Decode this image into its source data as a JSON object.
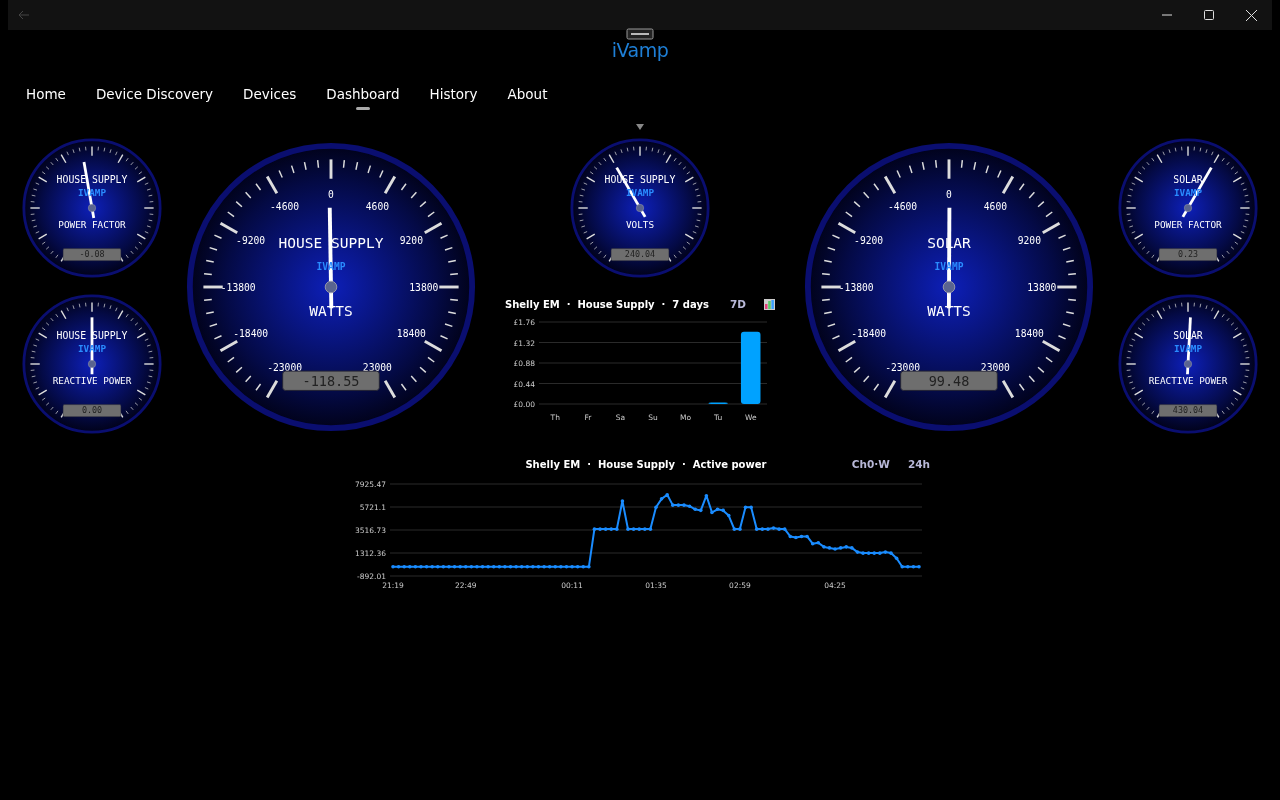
{
  "window": {
    "back_disabled": true
  },
  "app": {
    "logo": "iVamp"
  },
  "nav": [
    {
      "label": "Home",
      "selected": false
    },
    {
      "label": "Device Discovery",
      "selected": false
    },
    {
      "label": "Devices",
      "selected": false
    },
    {
      "label": "Dashboard",
      "selected": true
    },
    {
      "label": "History",
      "selected": false
    },
    {
      "label": "About",
      "selected": false
    }
  ],
  "gauges": [
    {
      "kind": "small",
      "title": "HOUSE SUPPLY",
      "brand": "IVAMP",
      "unit": "POWER FACTOR",
      "reading": "-0.08",
      "level": 0.467
    },
    {
      "kind": "small",
      "title": "HOUSE SUPPLY",
      "brand": "IVAMP",
      "unit": "REACTIVE POWER",
      "reading": "0.00",
      "level": 0.5
    },
    {
      "kind": "big",
      "title": "HOUSE SUPPLY",
      "brand": "IVAMP",
      "unit": "WATTS",
      "reading": "-118.55",
      "level": 0.497,
      "scale": [
        "0",
        "-4600",
        "4600",
        "-9200",
        "9200",
        "-13800",
        "13800",
        "-18400",
        "18400",
        "-23000",
        "23000"
      ]
    },
    {
      "kind": "small",
      "title": "HOUSE SUPPLY",
      "brand": "IVAMP",
      "unit": "VOLTS",
      "reading": "240.04",
      "level": 0.4
    },
    {
      "kind": "big",
      "title": "SOLAR",
      "brand": "IVAMP",
      "unit": "WATTS",
      "reading": "99.48",
      "level": 0.501,
      "scale": [
        "0",
        "-4600",
        "4600",
        "-9200",
        "9200",
        "-13800",
        "13800",
        "-18400",
        "18400",
        "-23000",
        "23000"
      ]
    },
    {
      "kind": "small",
      "title": "SOLAR",
      "brand": "IVAMP",
      "unit": "POWER FACTOR",
      "reading": "0.23",
      "level": 0.6
    },
    {
      "kind": "small",
      "title": "SOLAR",
      "brand": "IVAMP",
      "unit": "REACTIVE POWER",
      "reading": "430.04",
      "level": 0.51
    }
  ],
  "daily_chart": {
    "title": "Shelly EM  ·  House Supply  ·  7 days",
    "range": "7D",
    "chart_data": {
      "type": "bar",
      "grid": true,
      "categories": [
        "Th",
        "Fr",
        "Sa",
        "Su",
        "Mo",
        "Tu",
        "We"
      ],
      "series": [
        {
          "color": "#00a2ff",
          "values": [
            0,
            0,
            0,
            0,
            0,
            0.03,
            1.55
          ]
        }
      ],
      "ylim": [
        0,
        1.76
      ],
      "yticks": [
        {
          "value": 0,
          "label": "£0.00"
        },
        {
          "value": 0.44,
          "label": "£0.44"
        },
        {
          "value": 0.88,
          "label": "£0.88"
        },
        {
          "value": 1.32,
          "label": "£1.32"
        },
        {
          "value": 1.76,
          "label": "£1.76"
        }
      ]
    }
  },
  "power_chart": {
    "title": "Shelly EM  ·  House Supply  ·  Active power",
    "channel": "Ch0·W",
    "range": "24h",
    "chart_data": {
      "type": "line",
      "grid": true,
      "categories": [
        "21:19",
        null,
        null,
        null,
        null,
        null,
        null,
        null,
        null,
        null,
        null,
        null,
        null,
        "22:49",
        null,
        null,
        null,
        null,
        null,
        null,
        null,
        null,
        null,
        null,
        null,
        null,
        null,
        null,
        null,
        null,
        null,
        null,
        "00:11",
        null,
        null,
        null,
        null,
        null,
        null,
        null,
        null,
        null,
        null,
        null,
        null,
        null,
        null,
        "01:35",
        null,
        null,
        null,
        null,
        null,
        null,
        null,
        null,
        null,
        null,
        null,
        null,
        null,
        null,
        "02:59",
        null,
        null,
        null,
        null,
        null,
        null,
        null,
        null,
        null,
        null,
        null,
        null,
        null,
        null,
        null,
        null,
        "04:25",
        null,
        null,
        null,
        null,
        null,
        null,
        null,
        null,
        null,
        null,
        null,
        null,
        null,
        null,
        null
      ],
      "series": [
        {
          "color": "#1a8cff",
          "values": [
            0,
            0,
            0,
            0,
            0,
            0,
            0,
            0,
            0,
            0,
            0,
            0,
            0,
            0,
            0,
            0,
            0,
            0,
            0,
            0,
            0,
            0,
            0,
            0,
            0,
            0,
            0,
            0,
            0,
            0,
            0,
            0,
            0,
            0,
            0,
            0,
            3600,
            3600,
            3600,
            3600,
            3600,
            6300,
            3600,
            3600,
            3600,
            3600,
            3600,
            5700,
            6500,
            6900,
            5900,
            5900,
            5900,
            5800,
            5500,
            5400,
            6800,
            5200,
            5500,
            5400,
            4900,
            3600,
            3600,
            5700,
            5700,
            3600,
            3600,
            3600,
            3700,
            3600,
            3600,
            2900,
            2800,
            2900,
            2900,
            2200,
            2300,
            1900,
            1800,
            1700,
            1800,
            1900,
            1800,
            1400,
            1300,
            1300,
            1300,
            1300,
            1400,
            1300,
            800,
            0,
            0,
            0,
            0
          ]
        }
      ],
      "ylim": [
        -892.01,
        7925.47
      ],
      "yticks": [
        {
          "value": -892.01,
          "label": "-892.01"
        },
        {
          "value": 1312.36,
          "label": "1312.36"
        },
        {
          "value": 3516.73,
          "label": "3516.73"
        },
        {
          "value": 5721.1,
          "label": "5721.1"
        },
        {
          "value": 7925.47,
          "label": "7925.47"
        }
      ]
    }
  }
}
